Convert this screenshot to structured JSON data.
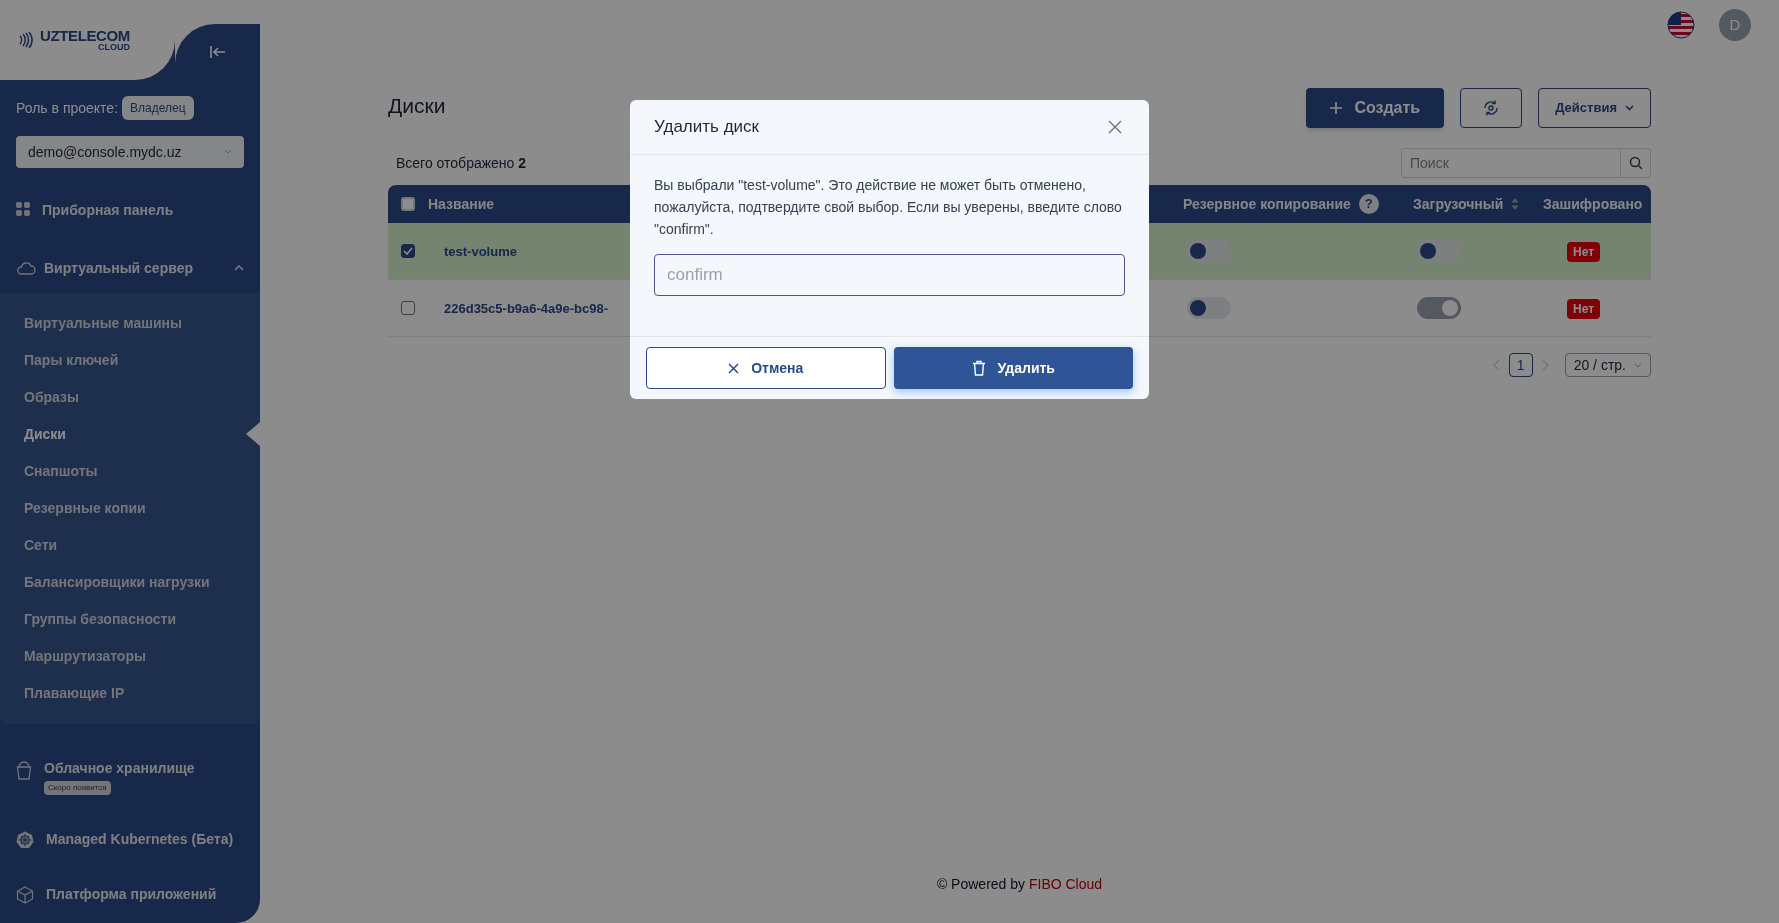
{
  "logo": {
    "name": "UZTELECOM",
    "sub": "CLOUD"
  },
  "sidebar": {
    "role_label": "Роль в проекте:",
    "role": "Владелец",
    "project": "demo@console.mydc.uz",
    "items": [
      {
        "kind": "link",
        "label": "Приборная панель"
      },
      {
        "kind": "group",
        "label": "Виртуальный сервер",
        "expanded": true,
        "children": [
          {
            "label": "Виртуальные машины",
            "selected": false
          },
          {
            "label": "Пары ключей",
            "selected": false
          },
          {
            "label": "Образы",
            "selected": false
          },
          {
            "label": "Диски",
            "selected": true
          },
          {
            "label": "Снапшоты",
            "selected": false
          },
          {
            "label": "Резервные копии",
            "selected": false
          },
          {
            "label": "Сети",
            "selected": false
          },
          {
            "label": "Балансировщики нагрузки",
            "selected": false
          },
          {
            "label": "Группы безопасности",
            "selected": false
          },
          {
            "label": "Маршрутизаторы",
            "selected": false
          },
          {
            "label": "Плавающие IP",
            "selected": false
          }
        ]
      },
      {
        "kind": "link",
        "label": "Облачное хранилище",
        "badge": "Скоро появится"
      },
      {
        "kind": "link",
        "label": "Managed Kubernetes (Бета)"
      },
      {
        "kind": "link",
        "label": "Платформа приложений"
      }
    ]
  },
  "topbar": {
    "avatar": "D"
  },
  "header": {
    "title": "Диски",
    "buttons": [
      {
        "kind": "primary",
        "label": "Создать"
      },
      {
        "kind": "icon"
      },
      {
        "kind": "dropdown",
        "label": "Действия"
      }
    ]
  },
  "summary": "Всего отображено **2**",
  "search": {
    "placeholder": "Поиск"
  },
  "table": {
    "all_checked": false,
    "columns": [
      {
        "label": "Название"
      },
      {
        "label": "Резервное копирование",
        "help": "?"
      },
      {
        "label": "Загрузочный",
        "sortable": true
      },
      {
        "label": "Зашифровано"
      }
    ],
    "rows": [
      {
        "selected": true,
        "checked": true,
        "name": "test-volume",
        "backup_on": false,
        "boot_on": false,
        "boot_disabled": false,
        "encrypted": "Нет"
      },
      {
        "selected": false,
        "checked": false,
        "name": "226d35c5-b9a6-4a9e-bc98-",
        "backup_on": false,
        "boot_on": true,
        "boot_disabled": true,
        "encrypted": "Нет"
      }
    ]
  },
  "pagination": {
    "pages": [
      {
        "label": "1",
        "selected": true
      }
    ],
    "page_size": "20 / стр."
  },
  "footer": {
    "prefix": "© Powered by",
    "brand": "FIBO Cloud"
  },
  "dialog": {
    "title": "Удалить диск",
    "message": "Вы выбрали \"test-volume\". Это действие не может быть отменено, пожалуйста, подтвердите свой выбор. Если вы уверены, введите слово \"confirm\".",
    "input": {
      "placeholder": "confirm"
    },
    "buttons": [
      {
        "kind": "cancel",
        "label": "Отмена"
      },
      {
        "kind": "danger",
        "label": "Удалить"
      }
    ]
  }
}
